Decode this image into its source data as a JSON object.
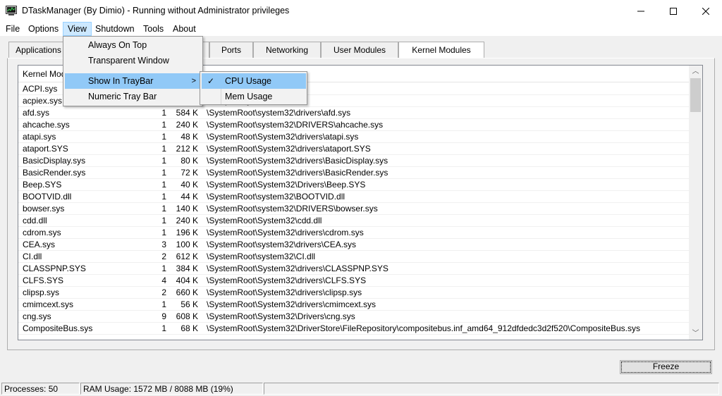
{
  "window": {
    "title": "DTaskManager (By Dimio) - Running without Administrator privileges",
    "icon": "task-manager-icon",
    "minimize": "—",
    "maximize": "☐",
    "close": "✕"
  },
  "menubar": [
    "File",
    "Options",
    "View",
    "Shutdown",
    "Tools",
    "About"
  ],
  "tabs": [
    "Applications",
    "",
    "",
    "Ports",
    "Networking",
    "User Modules",
    "Kernel Modules"
  ],
  "list": {
    "headers": [
      "Kernel Modu",
      "",
      "",
      ""
    ],
    "rows": [
      [
        "ACPI.sys",
        "",
        "",
        "rs\\ACPI.sys"
      ],
      [
        "acpiex.sys",
        "",
        "",
        "rs\\acpiex.sys"
      ],
      [
        "afd.sys",
        "1",
        "584 K",
        "\\SystemRoot\\system32\\drivers\\afd.sys"
      ],
      [
        "ahcache.sys",
        "1",
        "240 K",
        "\\SystemRoot\\system32\\DRIVERS\\ahcache.sys"
      ],
      [
        "atapi.sys",
        "1",
        "48 K",
        "\\SystemRoot\\System32\\drivers\\atapi.sys"
      ],
      [
        "ataport.SYS",
        "1",
        "212 K",
        "\\SystemRoot\\System32\\drivers\\ataport.SYS"
      ],
      [
        "BasicDisplay.sys",
        "1",
        "80 K",
        "\\SystemRoot\\System32\\drivers\\BasicDisplay.sys"
      ],
      [
        "BasicRender.sys",
        "1",
        "72 K",
        "\\SystemRoot\\System32\\drivers\\BasicRender.sys"
      ],
      [
        "Beep.SYS",
        "1",
        "40 K",
        "\\SystemRoot\\System32\\Drivers\\Beep.SYS"
      ],
      [
        "BOOTVID.dll",
        "1",
        "44 K",
        "\\SystemRoot\\system32\\BOOTVID.dll"
      ],
      [
        "bowser.sys",
        "1",
        "140 K",
        "\\SystemRoot\\system32\\DRIVERS\\bowser.sys"
      ],
      [
        "cdd.dll",
        "1",
        "240 K",
        "\\SystemRoot\\System32\\cdd.dll"
      ],
      [
        "cdrom.sys",
        "1",
        "196 K",
        "\\SystemRoot\\System32\\drivers\\cdrom.sys"
      ],
      [
        "CEA.sys",
        "3",
        "100 K",
        "\\SystemRoot\\system32\\drivers\\CEA.sys"
      ],
      [
        "CI.dll",
        "2",
        "612 K",
        "\\SystemRoot\\system32\\CI.dll"
      ],
      [
        "CLASSPNP.SYS",
        "1",
        "384 K",
        "\\SystemRoot\\System32\\drivers\\CLASSPNP.SYS"
      ],
      [
        "CLFS.SYS",
        "4",
        "404 K",
        "\\SystemRoot\\System32\\drivers\\CLFS.SYS"
      ],
      [
        "clipsp.sys",
        "2",
        "660 K",
        "\\SystemRoot\\System32\\drivers\\clipsp.sys"
      ],
      [
        "cmimcext.sys",
        "1",
        "56 K",
        "\\SystemRoot\\System32\\drivers\\cmimcext.sys"
      ],
      [
        "cng.sys",
        "9",
        "608 K",
        "\\SystemRoot\\System32\\Drivers\\cng.sys"
      ],
      [
        "CompositeBus.sys",
        "1",
        "68 K",
        "\\SystemRoot\\System32\\DriverStore\\FileRepository\\compositebus.inf_amd64_912dfdedc3d2f520\\CompositeBus.sys"
      ]
    ]
  },
  "scroll": {
    "up": "︿",
    "down": "﹀"
  },
  "freeze_label": "Freeze",
  "status": {
    "processes": "Processes: 50",
    "ram": "RAM Usage:  1572 MB / 8088 MB (19%)",
    "empty": ""
  },
  "view_menu": {
    "items": [
      "Always On Top",
      "Transparent Window",
      "Show In TrayBar",
      "Numeric Tray Bar"
    ],
    "submenu_arrow": ">",
    "submenu": [
      "CPU Usage",
      "Mem Usage"
    ],
    "check": "✓"
  }
}
